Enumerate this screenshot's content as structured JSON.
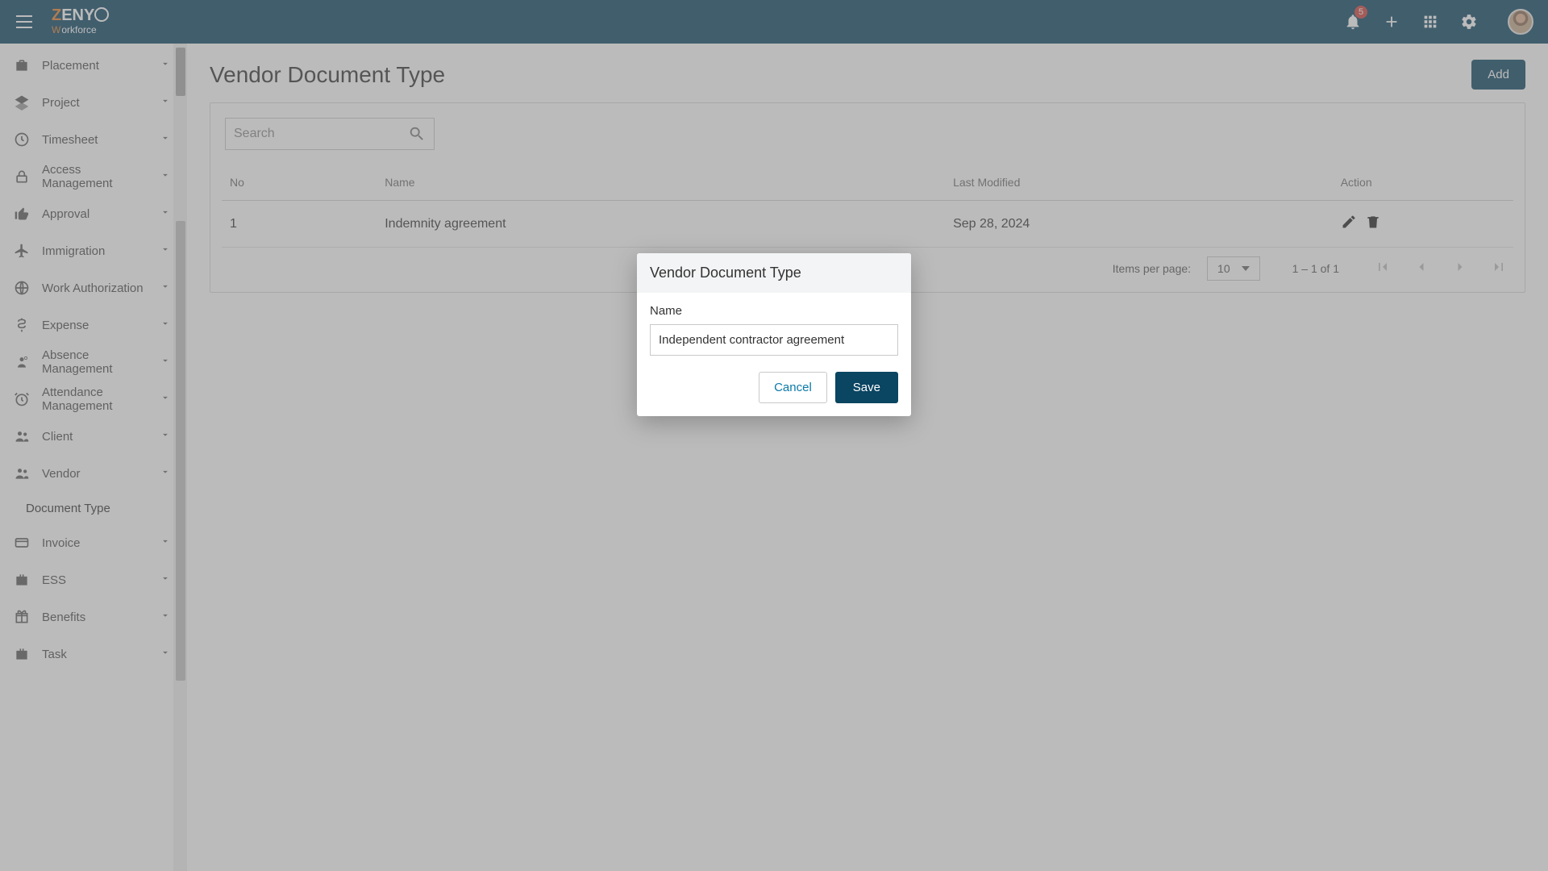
{
  "header": {
    "logo_main_first": "Z",
    "logo_main_rest": "ENY",
    "logo_sub1": "W",
    "logo_sub2": "orkforce",
    "notification_count": "5"
  },
  "sidebar": {
    "items": [
      {
        "icon": "briefcase",
        "label": "Placement",
        "expandable": true
      },
      {
        "icon": "layers",
        "label": "Project",
        "expandable": true
      },
      {
        "icon": "clock",
        "label": "Timesheet",
        "expandable": true
      },
      {
        "icon": "lock",
        "label": "Access Management",
        "expandable": true
      },
      {
        "icon": "thumb",
        "label": "Approval",
        "expandable": true
      },
      {
        "icon": "plane",
        "label": "Immigration",
        "expandable": true
      },
      {
        "icon": "globe",
        "label": "Work Authorization",
        "expandable": true
      },
      {
        "icon": "dollar",
        "label": "Expense",
        "expandable": true
      },
      {
        "icon": "person-off",
        "label": "Absence Management",
        "expandable": true
      },
      {
        "icon": "alarm",
        "label": "Attendance Management",
        "expandable": true
      },
      {
        "icon": "people",
        "label": "Client",
        "expandable": true
      },
      {
        "icon": "people",
        "label": "Vendor",
        "expandable": true,
        "open": true,
        "children": [
          "Document Type"
        ]
      },
      {
        "icon": "card",
        "label": "Invoice",
        "expandable": true
      },
      {
        "icon": "bag",
        "label": "ESS",
        "expandable": true
      },
      {
        "icon": "gift",
        "label": "Benefits",
        "expandable": true
      },
      {
        "icon": "bag",
        "label": "Task",
        "expandable": true
      }
    ]
  },
  "page": {
    "title": "Vendor Document Type",
    "add_label": "Add",
    "search_placeholder": "Search",
    "columns": {
      "no": "No",
      "name": "Name",
      "last_modified": "Last Modified",
      "action": "Action"
    },
    "rows": [
      {
        "no": "1",
        "name": "Indemnity agreement",
        "last_modified": "Sep 28, 2024"
      }
    ],
    "paginator": {
      "ipp_label": "Items per page:",
      "ipp_value": "10",
      "range": "1 – 1 of 1"
    }
  },
  "modal": {
    "title": "Vendor Document Type",
    "name_label": "Name",
    "name_value": "Independent contractor agreement",
    "cancel": "Cancel",
    "save": "Save"
  }
}
